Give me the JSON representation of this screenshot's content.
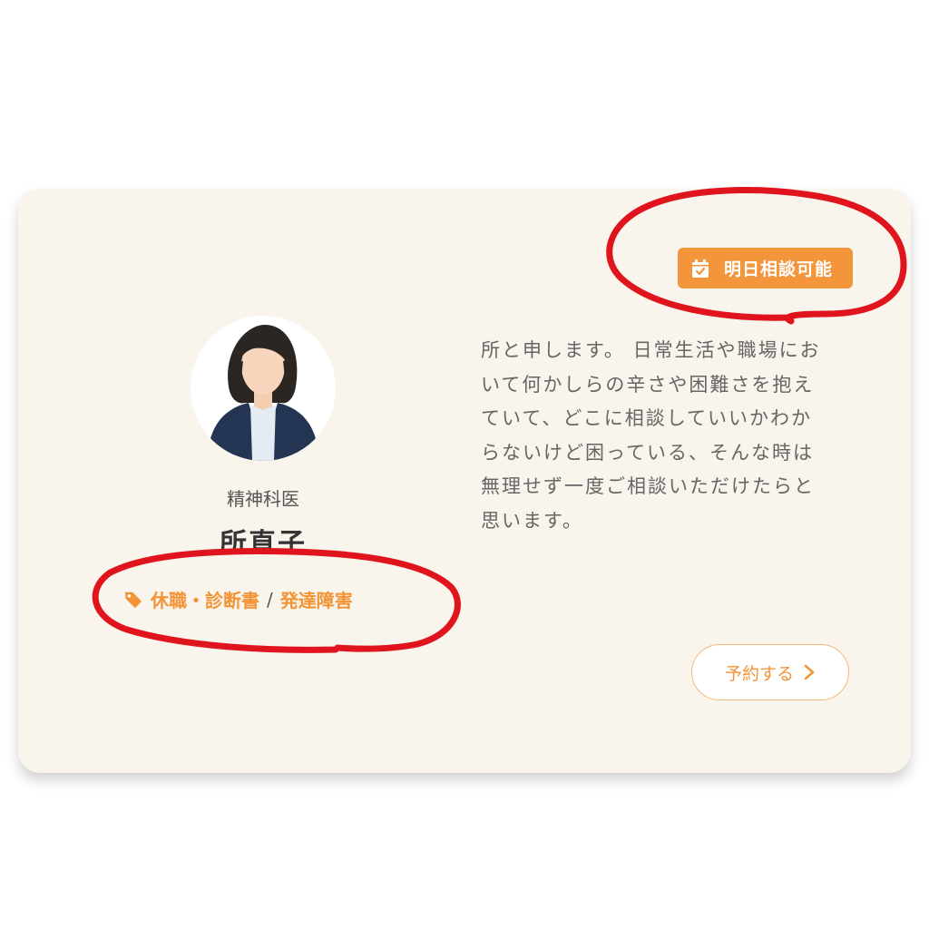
{
  "header": {
    "truncated_text": "・ ・ ・ ・ ・ ・ ・ ・ ・ ・ ・ ・ ・ ・ ・ ・ ・ ・ ・ ・ ・ ・ ・"
  },
  "card": {
    "badge": {
      "icon": "calendar-check-icon",
      "label": "明日相談可能",
      "color": "#f3953a"
    },
    "doctor": {
      "specialty": "精神科医",
      "name": "所直子"
    },
    "tags": {
      "icon": "tag-icon",
      "items": [
        "休職・診断書",
        "発達障害"
      ],
      "separator": "/"
    },
    "description": {
      "lines": [
        "所と申します。 日常生活や職場にお",
        "いて何かしらの辛さや困難さを抱え",
        "ていて、どこに相談していいかわか",
        "らないけど困っている、そんな時は",
        "無理せず一度ご相談いただけたらと",
        "思います。"
      ]
    },
    "reserve_button": {
      "label": "予約する",
      "icon": "chevron-right-icon"
    },
    "accent_color": "#f29436",
    "background_color": "#f9f4ec"
  }
}
